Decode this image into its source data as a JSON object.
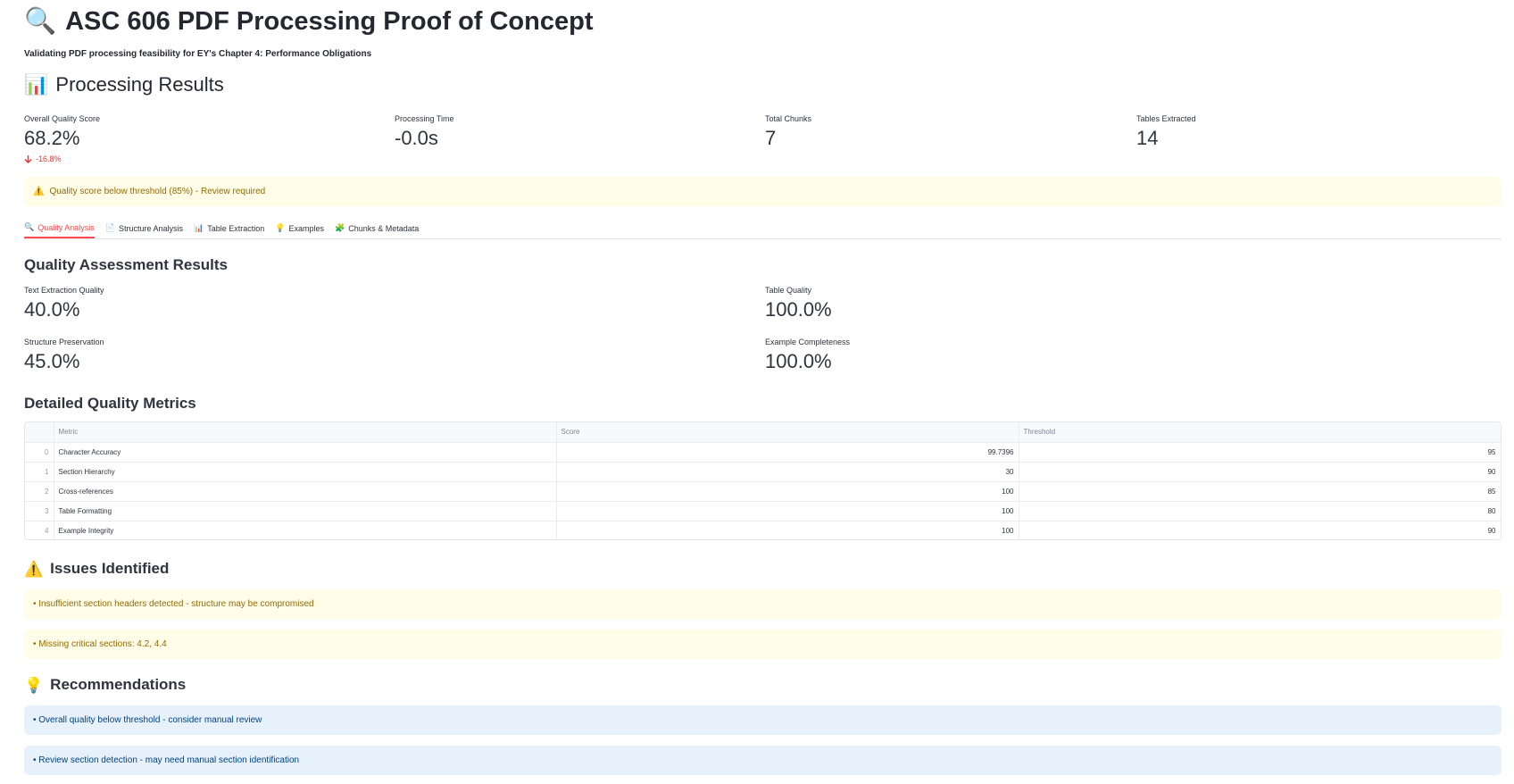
{
  "header": {
    "title_icon": "🔍",
    "title": "ASC 606 PDF Processing Proof of Concept",
    "subtitle": "Validating PDF processing feasibility for EY's Chapter 4: Performance Obligations"
  },
  "results": {
    "icon": "📊",
    "heading": "Processing Results",
    "metrics": [
      {
        "label": "Overall Quality Score",
        "value": "68.2%",
        "delta": "-16.8%"
      },
      {
        "label": "Processing Time",
        "value": "-0.0s"
      },
      {
        "label": "Total Chunks",
        "value": "7"
      },
      {
        "label": "Tables Extracted",
        "value": "14"
      }
    ],
    "warning_icon": "⚠️",
    "warning": "Quality score below threshold (85%) - Review required"
  },
  "tabs": [
    {
      "icon": "🔍",
      "label": "Quality Analysis",
      "active": true
    },
    {
      "icon": "📄",
      "label": "Structure Analysis"
    },
    {
      "icon": "📊",
      "label": "Table Extraction"
    },
    {
      "icon": "💡",
      "label": "Examples"
    },
    {
      "icon": "🧩",
      "label": "Chunks & Metadata"
    }
  ],
  "quality": {
    "heading": "Quality Assessment Results",
    "metrics": [
      {
        "label": "Text Extraction Quality",
        "value": "40.0%"
      },
      {
        "label": "Table Quality",
        "value": "100.0%"
      },
      {
        "label": "Structure Preservation",
        "value": "45.0%"
      },
      {
        "label": "Example Completeness",
        "value": "100.0%"
      }
    ]
  },
  "detailed": {
    "heading": "Detailed Quality Metrics",
    "columns": [
      "",
      "Metric",
      "Score",
      "Threshold"
    ],
    "rows": [
      {
        "idx": "0",
        "metric": "Character Accuracy",
        "score": "99.7396",
        "threshold": "95"
      },
      {
        "idx": "1",
        "metric": "Section Hierarchy",
        "score": "30",
        "threshold": "90"
      },
      {
        "idx": "2",
        "metric": "Cross-references",
        "score": "100",
        "threshold": "85"
      },
      {
        "idx": "3",
        "metric": "Table Formatting",
        "score": "100",
        "threshold": "80"
      },
      {
        "idx": "4",
        "metric": "Example Integrity",
        "score": "100",
        "threshold": "90"
      }
    ]
  },
  "issues": {
    "icon": "⚠️",
    "heading": "Issues Identified",
    "items": [
      "• Insufficient section headers detected - structure may be compromised",
      "• Missing critical sections: 4.2, 4.4"
    ]
  },
  "recommendations": {
    "icon": "💡",
    "heading": "Recommendations",
    "items": [
      "• Overall quality below threshold - consider manual review",
      "• Review section detection - may need manual section identification"
    ]
  },
  "colors": {
    "accent": "#ff4b4b",
    "delta_negative": "#ff2b2b",
    "warning_bg": "#fffce7",
    "warning_text": "#926c05",
    "info_bg": "#e7f1fb",
    "info_text": "#004280"
  }
}
